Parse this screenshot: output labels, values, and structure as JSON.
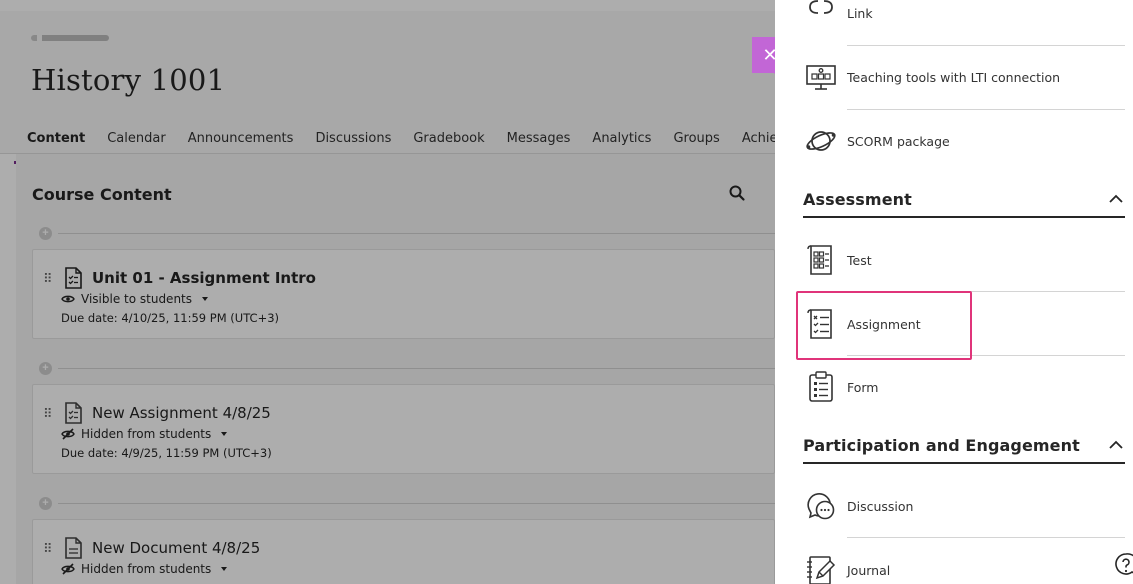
{
  "course": {
    "title": "History 1001",
    "tabs": [
      {
        "label": "Content",
        "active": true
      },
      {
        "label": "Calendar"
      },
      {
        "label": "Announcements"
      },
      {
        "label": "Discussions"
      },
      {
        "label": "Gradebook"
      },
      {
        "label": "Messages"
      },
      {
        "label": "Analytics"
      },
      {
        "label": "Groups"
      },
      {
        "label": "Achiever"
      }
    ],
    "section_title": "Course Content",
    "items": [
      {
        "name": "Unit 01 - Assignment Intro",
        "visibility": "Visible to students",
        "due": "Due date: 4/10/25, 11:59 PM (UTC+3)"
      },
      {
        "name": "New Assignment 4/8/25",
        "visibility": "Hidden from students",
        "due": "Due date: 4/9/25, 11:59 PM (UTC+3)"
      },
      {
        "name": "New Document 4/8/25",
        "visibility": "Hidden from students",
        "due": ""
      }
    ]
  },
  "panel": {
    "top_items": [
      {
        "label": "Link",
        "icon": "link-icon"
      },
      {
        "label": "Teaching tools with LTI connection",
        "icon": "lti-tools-icon"
      },
      {
        "label": "SCORM package",
        "icon": "scorm-package-icon"
      }
    ],
    "assessment": {
      "heading": "Assessment",
      "items": [
        {
          "label": "Test",
          "icon": "test-icon"
        },
        {
          "label": "Assignment",
          "icon": "assignment-icon",
          "highlighted": true
        },
        {
          "label": "Form",
          "icon": "form-icon"
        }
      ]
    },
    "participation": {
      "heading": "Participation and Engagement",
      "items": [
        {
          "label": "Discussion",
          "icon": "discussion-icon"
        },
        {
          "label": "Journal",
          "icon": "journal-icon"
        }
      ]
    }
  },
  "colors": {
    "accent": "#7b2d8e",
    "close_flag": "#c266d6",
    "highlight": "#e0347a"
  }
}
